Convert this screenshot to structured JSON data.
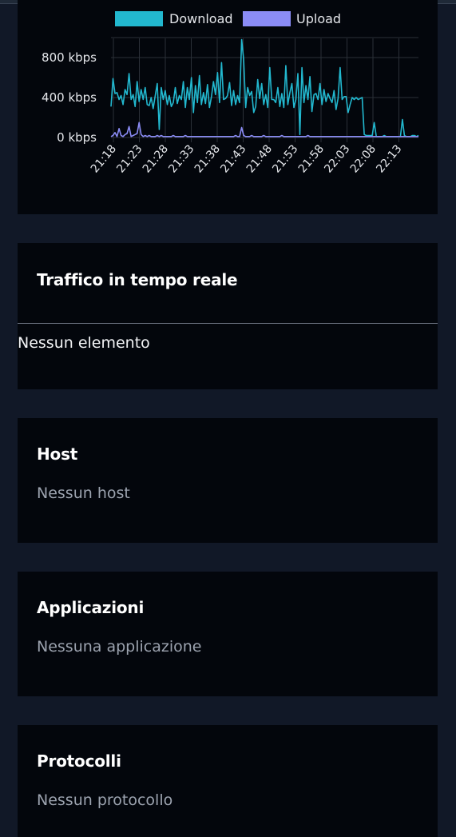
{
  "colors": {
    "page_bg": "#111827",
    "card_bg": "#03060c",
    "download": "#22b8cf",
    "upload": "#8b8cf6",
    "grid": "#2b3038"
  },
  "chart_data": {
    "type": "line",
    "legend": [
      "Download",
      "Upload"
    ],
    "legend_position": "top",
    "grid": true,
    "y_ticks": [
      "0 kbps",
      "400 kbps",
      "800 kbps"
    ],
    "ylim": [
      0,
      1000
    ],
    "x_ticks": [
      "21:18",
      "21:23",
      "21:28",
      "21:33",
      "21:38",
      "21:43",
      "21:48",
      "21:53",
      "21:58",
      "22:03",
      "22:08",
      "22:13"
    ],
    "series": [
      {
        "name": "Download",
        "color": "#22b8cf",
        "values": [
          310,
          590,
          440,
          450,
          380,
          420,
          330,
          480,
          430,
          640,
          380,
          430,
          310,
          560,
          360,
          480,
          380,
          500,
          330,
          320,
          400,
          290,
          420,
          540,
          80,
          500,
          380,
          470,
          330,
          420,
          310,
          350,
          500,
          340,
          420,
          380,
          560,
          300,
          500,
          380,
          600,
          250,
          520,
          350,
          620,
          330,
          450,
          340,
          530,
          300,
          410,
          560,
          430,
          650,
          350,
          750,
          380,
          390,
          420,
          550,
          320,
          470,
          330,
          420,
          350,
          980,
          780,
          300,
          500,
          420,
          460,
          250,
          310,
          580,
          390,
          540,
          330,
          430,
          300,
          700,
          380,
          380,
          350,
          500,
          310,
          440,
          300,
          720,
          330,
          450,
          540,
          300,
          380,
          640,
          30,
          700,
          350,
          520,
          380,
          610,
          260,
          430,
          440,
          380,
          540,
          330,
          480,
          360,
          440,
          390,
          350,
          470,
          280,
          390,
          700,
          380,
          410,
          410,
          250,
          330,
          400,
          380,
          400,
          380,
          390,
          400,
          30,
          20,
          20,
          20,
          20,
          150,
          10,
          10,
          10,
          10,
          20,
          10,
          10,
          10,
          10,
          10,
          10,
          10,
          10,
          180,
          20,
          10,
          10,
          10,
          20,
          20,
          10,
          20
        ]
      },
      {
        "name": "Upload",
        "color": "#8b8cf6",
        "values": [
          10,
          20,
          50,
          10,
          90,
          20,
          10,
          30,
          40,
          110,
          10,
          20,
          30,
          40,
          150,
          30,
          10,
          20,
          10,
          20,
          10,
          10,
          10,
          20,
          10,
          20,
          10,
          10,
          10,
          10,
          10,
          20,
          10,
          10,
          10,
          10,
          10,
          20,
          10,
          10,
          10,
          10,
          10,
          10,
          10,
          10,
          10,
          10,
          10,
          10,
          10,
          10,
          10,
          10,
          10,
          10,
          10,
          10,
          10,
          10,
          10,
          10,
          20,
          10,
          10,
          100,
          20,
          10,
          10,
          10,
          20,
          10,
          10,
          10,
          10,
          10,
          20,
          10,
          10,
          10,
          10,
          10,
          10,
          10,
          10,
          20,
          10,
          10,
          10,
          10,
          10,
          10,
          10,
          10,
          10,
          10,
          10,
          10,
          20,
          10,
          10,
          10,
          10,
          10,
          10,
          10,
          10,
          10,
          10,
          10,
          10,
          10,
          10,
          10,
          10,
          10,
          10,
          10,
          10,
          10,
          10,
          10,
          10,
          10,
          10,
          10,
          10,
          10,
          10,
          10,
          10,
          10,
          10,
          10,
          10,
          10,
          10,
          10,
          10,
          10,
          10,
          10,
          10,
          10,
          10,
          10,
          10,
          10,
          10,
          10,
          10,
          10,
          10,
          10
        ]
      }
    ]
  },
  "realtime": {
    "title": "Traffico in tempo reale",
    "empty_text": "Nessun elemento"
  },
  "hosts": {
    "title": "Host",
    "empty_text": "Nessun host"
  },
  "apps": {
    "title": "Applicazioni",
    "empty_text": "Nessuna applicazione"
  },
  "protocols": {
    "title": "Protocolli",
    "empty_text": "Nessun protocollo"
  }
}
